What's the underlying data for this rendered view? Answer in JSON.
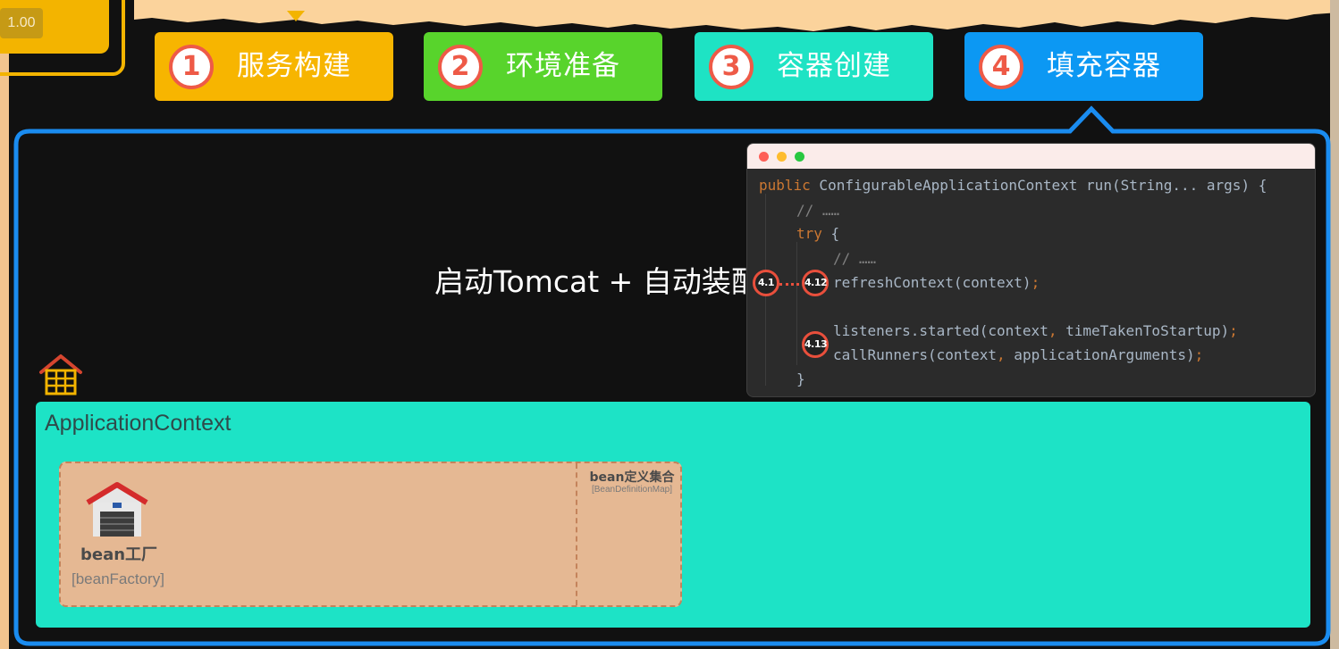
{
  "zoom": {
    "value": "1.00"
  },
  "steps": [
    {
      "num": "1",
      "label": "服务构建",
      "color": "#f7b500"
    },
    {
      "num": "2",
      "label": "环境准备",
      "color": "#58d42c"
    },
    {
      "num": "3",
      "label": "容器创建",
      "color": "#1ee3c4"
    },
    {
      "num": "4",
      "label": "填充容器",
      "color": "#0c98f3"
    }
  ],
  "heading": "启动Tomcat + 自动装配",
  "code": {
    "l1_kw": "public",
    "l1_rest": " ConfigurableApplicationContext run(String... args) {",
    "l2": "// ……",
    "l3_kw": "try",
    "l3_rest": " {",
    "l4": "// ……",
    "l5_a": "refreshContext(context)",
    "l5_b": ";",
    "l6_a": "listeners.started(context",
    "l6_b": ",",
    "l6_c": " timeTakenToStartup)",
    "l6_d": ";",
    "l7_a": "callRunners(context",
    "l7_b": ",",
    "l7_c": " applicationArguments)",
    "l7_d": ";",
    "l8": "}"
  },
  "markers": {
    "m41": "4.1",
    "m412": "4.12",
    "m413": "4.13"
  },
  "app_context": {
    "label": "ApplicationContext",
    "bean_factory_title": "bean工厂",
    "bean_factory_sub": "[beanFactory]",
    "bean_def_title": "bean定义集合",
    "bean_def_sub": "[BeanDefinitionMap]"
  },
  "colors": {
    "frame_blue": "#1a8cf0",
    "accent_red": "#e94f3c",
    "context_teal": "#1de3c6",
    "bean_box": "#e5b893"
  }
}
